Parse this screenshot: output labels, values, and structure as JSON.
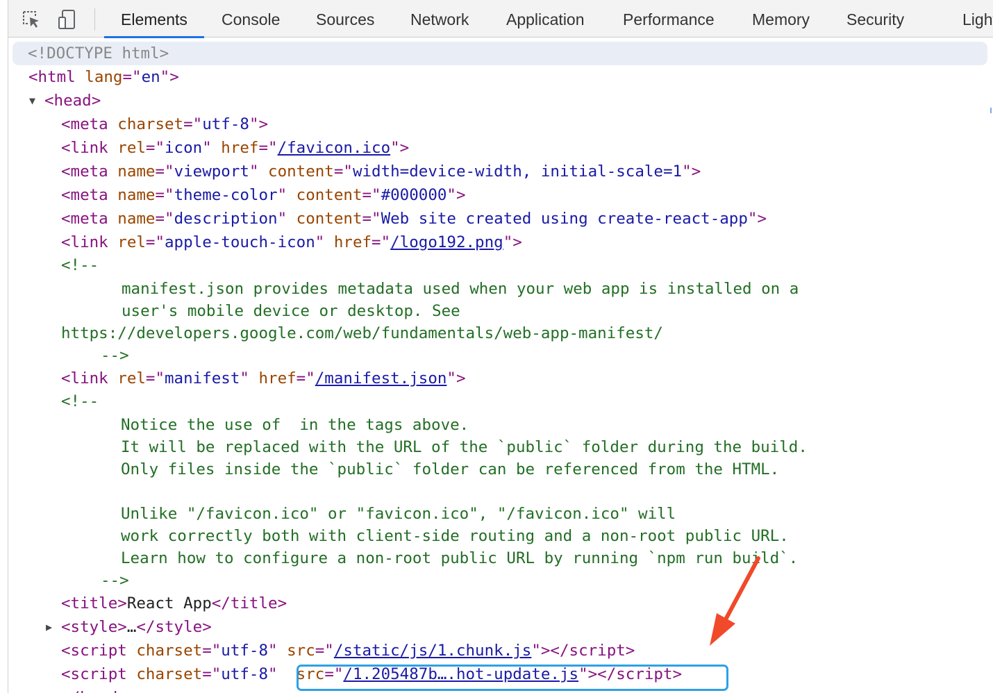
{
  "tabs": [
    {
      "label": "Elements",
      "active": true
    },
    {
      "label": "Console"
    },
    {
      "label": "Sources"
    },
    {
      "label": "Network"
    },
    {
      "label": "Application"
    },
    {
      "label": "Performance"
    },
    {
      "label": "Memory"
    },
    {
      "label": "Security"
    },
    {
      "label": "Lighth"
    }
  ],
  "icons": {
    "inspect": "inspect-element-icon",
    "device": "device-toolbar-icon"
  },
  "colors": {
    "tag": "#881280",
    "attr_name": "#994500",
    "attr_value": "#1a1aa6",
    "comment": "#236e25",
    "highlight": "#2da0e6",
    "arrow": "#f04a2a"
  },
  "dom": {
    "doctype": "<!DOCTYPE html>",
    "html_open": {
      "tag": "html",
      "attr": "lang",
      "value": "en"
    },
    "head": "head",
    "meta_charset": {
      "attr": "charset",
      "value": "utf-8"
    },
    "link_icon": {
      "rel": "icon",
      "href": "/favicon.ico"
    },
    "meta_viewport": {
      "name": "viewport",
      "content": "width=device-width, initial-scale=1"
    },
    "meta_theme": {
      "name": "theme-color",
      "content": "#000000"
    },
    "meta_desc": {
      "name": "description",
      "content": "Web site created using create-react-app"
    },
    "link_apple": {
      "rel": "apple-touch-icon",
      "href": "/logo192.png"
    },
    "comment1": [
      "<!--",
      "manifest.json provides metadata used when your web app is installed on a",
      "user's mobile device or desktop. See",
      "https://developers.google.com/web/fundamentals/web-app-manifest/",
      "-->"
    ],
    "link_manifest": {
      "rel": "manifest",
      "href": "/manifest.json"
    },
    "comment2": [
      "<!--",
      "Notice the use of  in the tags above.",
      "It will be replaced with the URL of the `public` folder during the build.",
      "Only files inside the `public` folder can be referenced from the HTML.",
      "Unlike \"/favicon.ico\" or \"favicon.ico\", \"/favicon.ico\" will",
      "work correctly both with client-side routing and a non-root public URL.",
      "Learn how to configure a non-root public URL by running `npm run build`.",
      "-->"
    ],
    "title": {
      "tag": "title",
      "text": "React App"
    },
    "style": {
      "tag": "style",
      "ellipsis": "…"
    },
    "script1": {
      "charset": "utf-8",
      "src": "/static/js/1.chunk.js"
    },
    "script2": {
      "charset": "utf-8",
      "src": "/1.205487b….hot-update.js"
    }
  }
}
